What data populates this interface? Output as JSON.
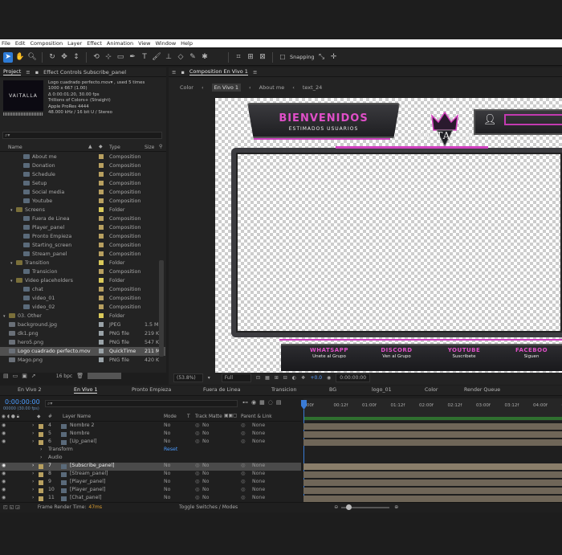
{
  "menu": [
    "File",
    "Edit",
    "Composition",
    "Layer",
    "Effect",
    "Animation",
    "View",
    "Window",
    "Help"
  ],
  "toolbar": {
    "snapping_label": "Snapping"
  },
  "project_panel": {
    "tab_project": "Project",
    "tab_effect_controls": "Effect Controls Subscribe_panel",
    "preview": {
      "filename": "Logo cuadrado perfecto.mov▾ , used 5 times",
      "dims": "1000 x 667 (1.00)",
      "duration": "Δ 0:00:01:20, 30.00 fps",
      "colors": "Trillions of Colors+ (Straight)",
      "codec": "Apple ProRes 4444",
      "audio": "48.000 kHz / 16 bit U / Stereo",
      "thumb_text": "VAITALLA"
    },
    "search_placeholder": "⌕▾",
    "headers": {
      "name": "Name",
      "type": "Type",
      "size": "Size"
    },
    "items": [
      {
        "name": "About me",
        "type": "Composition",
        "size": "",
        "indent": 2,
        "kind": "comp",
        "color": "#b8a060"
      },
      {
        "name": "Donation",
        "type": "Composition",
        "size": "",
        "indent": 2,
        "kind": "comp",
        "color": "#b8a060"
      },
      {
        "name": "Schedule",
        "type": "Composition",
        "size": "",
        "indent": 2,
        "kind": "comp",
        "color": "#b8a060"
      },
      {
        "name": "Setup",
        "type": "Composition",
        "size": "",
        "indent": 2,
        "kind": "comp",
        "color": "#b8a060"
      },
      {
        "name": "Social media",
        "type": "Composition",
        "size": "",
        "indent": 2,
        "kind": "comp",
        "color": "#b8a060"
      },
      {
        "name": "Youtube",
        "type": "Composition",
        "size": "",
        "indent": 2,
        "kind": "comp",
        "color": "#b8a060"
      },
      {
        "name": "Screens",
        "type": "Folder",
        "size": "",
        "indent": 1,
        "kind": "folder",
        "color": "#d9c95a"
      },
      {
        "name": "Fuera de Linea",
        "type": "Composition",
        "size": "",
        "indent": 2,
        "kind": "comp",
        "color": "#b8a060"
      },
      {
        "name": "Player_panel",
        "type": "Composition",
        "size": "",
        "indent": 2,
        "kind": "comp",
        "color": "#b8a060"
      },
      {
        "name": "Pronto Empieza",
        "type": "Composition",
        "size": "",
        "indent": 2,
        "kind": "comp",
        "color": "#b8a060"
      },
      {
        "name": "Starting_screen",
        "type": "Composition",
        "size": "",
        "indent": 2,
        "kind": "comp",
        "color": "#b8a060"
      },
      {
        "name": "Stream_panel",
        "type": "Composition",
        "size": "",
        "indent": 2,
        "kind": "comp",
        "color": "#b8a060"
      },
      {
        "name": "Transition",
        "type": "Folder",
        "size": "",
        "indent": 1,
        "kind": "folder",
        "color": "#d9c95a"
      },
      {
        "name": "Transicion",
        "type": "Composition",
        "size": "",
        "indent": 2,
        "kind": "comp",
        "color": "#b8a060"
      },
      {
        "name": "Video placeholders",
        "type": "Folder",
        "size": "",
        "indent": 1,
        "kind": "folder",
        "color": "#d9c95a"
      },
      {
        "name": "chat",
        "type": "Composition",
        "size": "",
        "indent": 2,
        "kind": "comp",
        "color": "#b8a060"
      },
      {
        "name": "video_01",
        "type": "Composition",
        "size": "",
        "indent": 2,
        "kind": "comp",
        "color": "#b8a060"
      },
      {
        "name": "video_02",
        "type": "Composition",
        "size": "",
        "indent": 2,
        "kind": "comp",
        "color": "#b8a060"
      },
      {
        "name": "03. Other",
        "type": "Folder",
        "size": "",
        "indent": 0,
        "kind": "folder",
        "color": "#d9c95a"
      },
      {
        "name": "background.jpg",
        "type": "JPEG",
        "size": "1.5 M",
        "indent": 0,
        "kind": "file",
        "color": "#9aa3a8"
      },
      {
        "name": "dk1.png",
        "type": "PNG file",
        "size": "219 K",
        "indent": 0,
        "kind": "file",
        "color": "#9aa3a8"
      },
      {
        "name": "hero5.png",
        "type": "PNG file",
        "size": "547 K",
        "indent": 0,
        "kind": "file",
        "color": "#9aa3a8"
      },
      {
        "name": "Logo cuadrado perfecto.mov",
        "type": "QuickTime",
        "size": "211 M",
        "indent": 0,
        "kind": "file",
        "color": "#9aa3a8",
        "selected": true
      },
      {
        "name": "Mago.png",
        "type": "PNG file",
        "size": "420 K",
        "indent": 0,
        "kind": "file",
        "color": "#9aa3a8"
      }
    ],
    "bpc": "16 bpc"
  },
  "composition": {
    "tab": "Composition En Vivo 1",
    "breadcrumbs": [
      "Color",
      "En Vivo 1",
      "About me",
      "text_24"
    ],
    "overlay": {
      "banner_title": "BIENVENIDOS",
      "banner_subtitle": "ESTIMADOS USUARIOS",
      "logo_text": "VAITALLA",
      "socials": [
        {
          "name": "WHATSAPP",
          "sub": "Unete al Grupo"
        },
        {
          "name": "DISCORD",
          "sub": "Ven al Grupo"
        },
        {
          "name": "YOUTUBE",
          "sub": "Suscribete"
        },
        {
          "name": "FACEBOO",
          "sub": "Siguen"
        }
      ]
    },
    "zoom": "(53.8%)",
    "resolution": "Full",
    "exposure": "+0.0",
    "timecode": "0:00:00:00"
  },
  "timeline": {
    "tabs": [
      "En Vivo 2",
      "En Vivo 1",
      "Pronto Empieza",
      "Fuera de Linea",
      "Transicion",
      "BG",
      "logo_01",
      "Color",
      "Render Queue"
    ],
    "active_tab": "En Vivo 1",
    "current_time": "0:00:00:00",
    "fps_label": "00000 (30.00 fps)",
    "columns": {
      "layer_name": "Layer Name",
      "mode": "Mode",
      "t": "T",
      "track_matte": "Track Matte",
      "parent": "Parent & Link"
    },
    "ruler": [
      ":00f",
      "00:12f",
      "01:00f",
      "01:12f",
      "02:00f",
      "02:12f",
      "03:00f",
      "03:12f",
      "04:00f",
      "04:12"
    ],
    "layers": [
      {
        "index": "4",
        "name": "Nombre 2",
        "mode": "No",
        "matte": "No",
        "parent": "None",
        "color": "#b8a060"
      },
      {
        "index": "5",
        "name": "Nombre",
        "mode": "No",
        "matte": "No",
        "parent": "None",
        "color": "#b8a060"
      },
      {
        "index": "6",
        "name": "[Up_panel]",
        "mode": "No",
        "matte": "No",
        "parent": "None",
        "color": "#b8a060"
      }
    ],
    "transform_label": "Transform",
    "reset_label": "Reset",
    "audio_label": "Audio",
    "layers2": [
      {
        "index": "7",
        "name": "[Subscribe_panel]",
        "mode": "No",
        "matte": "No",
        "parent": "None",
        "color": "#b8a060",
        "selected": true
      },
      {
        "index": "8",
        "name": "[Stream_panel]",
        "mode": "No",
        "matte": "No",
        "parent": "None",
        "color": "#b8a060"
      },
      {
        "index": "9",
        "name": "[Player_panel]",
        "mode": "No",
        "matte": "No",
        "parent": "None",
        "color": "#b8a060"
      },
      {
        "index": "10",
        "name": "[Player_panel]",
        "mode": "No",
        "matte": "No",
        "parent": "None",
        "color": "#b8a060"
      },
      {
        "index": "11",
        "name": "[Chat_panel]",
        "mode": "No",
        "matte": "No",
        "parent": "None",
        "color": "#b8a060"
      }
    ],
    "render_time_label": "Frame Render Time:",
    "render_time_value": "47ms",
    "toggle_label": "Toggle Switches / Modes"
  }
}
